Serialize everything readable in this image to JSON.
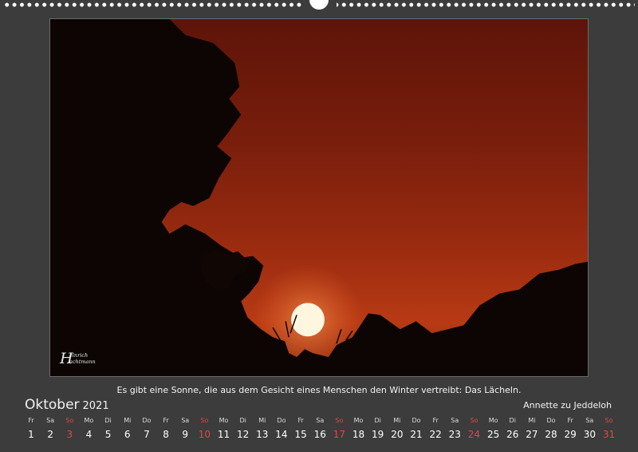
{
  "caption": "Es gibt eine Sonne, die aus dem Gesicht eines Menschen den Winter vertreibt: Das Lächeln.",
  "calendar": {
    "month": "Oktober",
    "year": "2021",
    "author": "Annette zu Jeddeloh",
    "days": [
      {
        "dow": "Fr",
        "num": "1",
        "sunday": false
      },
      {
        "dow": "Sa",
        "num": "2",
        "sunday": false
      },
      {
        "dow": "So",
        "num": "3",
        "sunday": true
      },
      {
        "dow": "Mo",
        "num": "4",
        "sunday": false
      },
      {
        "dow": "Di",
        "num": "5",
        "sunday": false
      },
      {
        "dow": "Mi",
        "num": "6",
        "sunday": false
      },
      {
        "dow": "Do",
        "num": "7",
        "sunday": false
      },
      {
        "dow": "Fr",
        "num": "8",
        "sunday": false
      },
      {
        "dow": "Sa",
        "num": "9",
        "sunday": false
      },
      {
        "dow": "So",
        "num": "10",
        "sunday": true
      },
      {
        "dow": "Mo",
        "num": "11",
        "sunday": false
      },
      {
        "dow": "Di",
        "num": "12",
        "sunday": false
      },
      {
        "dow": "Mi",
        "num": "13",
        "sunday": false
      },
      {
        "dow": "Do",
        "num": "14",
        "sunday": false
      },
      {
        "dow": "Fr",
        "num": "15",
        "sunday": false
      },
      {
        "dow": "Sa",
        "num": "16",
        "sunday": false
      },
      {
        "dow": "So",
        "num": "17",
        "sunday": true
      },
      {
        "dow": "Mo",
        "num": "18",
        "sunday": false
      },
      {
        "dow": "Di",
        "num": "19",
        "sunday": false
      },
      {
        "dow": "Mi",
        "num": "20",
        "sunday": false
      },
      {
        "dow": "Do",
        "num": "21",
        "sunday": false
      },
      {
        "dow": "Fr",
        "num": "22",
        "sunday": false
      },
      {
        "dow": "Sa",
        "num": "23",
        "sunday": false
      },
      {
        "dow": "So",
        "num": "24",
        "sunday": true
      },
      {
        "dow": "Mo",
        "num": "25",
        "sunday": false
      },
      {
        "dow": "Di",
        "num": "26",
        "sunday": false
      },
      {
        "dow": "Mi",
        "num": "27",
        "sunday": false
      },
      {
        "dow": "Do",
        "num": "28",
        "sunday": false
      },
      {
        "dow": "Fr",
        "num": "29",
        "sunday": false
      },
      {
        "dow": "Sa",
        "num": "30",
        "sunday": false
      },
      {
        "dow": "So",
        "num": "31",
        "sunday": true
      }
    ]
  },
  "photo": {
    "signature": {
      "initial_1": "H",
      "line_1": "einrich",
      "line_2": "achtmann"
    }
  },
  "colors": {
    "background": "#3c3c3c",
    "sunday": "#e0483e",
    "sky_top": "#5e1409",
    "sky_bottom": "#b83a14",
    "sun": "#fff6e0"
  }
}
